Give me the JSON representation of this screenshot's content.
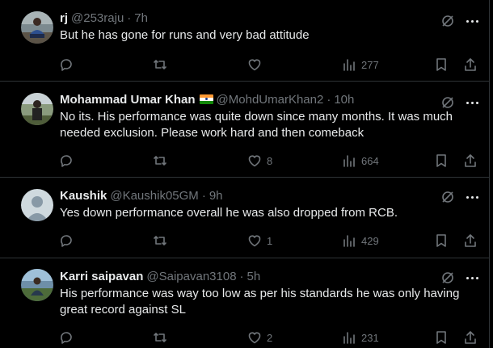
{
  "tweets": [
    {
      "name": "rj",
      "handle": "@253raju",
      "sep": "·",
      "time": "7h",
      "text": "But he has gone for runs and very bad attitude",
      "likes": "",
      "views": "277",
      "avatar": "man-sitting-photo"
    },
    {
      "name": "Mohammad Umar Khan",
      "handle": "@MohdUmarKhan2",
      "sep": "·",
      "time": "10h",
      "text": "No its. His performance was quite down since many months. It was much needed exclusion. Please work hard and then comeback",
      "likes": "8",
      "views": "664",
      "avatar": "man-outdoor-photo",
      "flag": "india-flag"
    },
    {
      "name": "Kaushik",
      "handle": "@Kaushik05GM",
      "sep": "·",
      "time": "9h",
      "text": "Yes down performance overall he was also dropped from RCB.",
      "likes": "1",
      "views": "429",
      "avatar": "default-avatar"
    },
    {
      "name": "Karri saipavan",
      "handle": "@Saipavan3108",
      "sep": "·",
      "time": "5h",
      "text": "His performance was way too low as per his standards he was only having great record against SL",
      "likes": "2",
      "views": "231",
      "avatar": "man-landscape-photo"
    }
  ],
  "colors": {
    "background": "#000000",
    "text": "#e7e9ea",
    "muted": "#71767b",
    "border": "#2f3336"
  }
}
